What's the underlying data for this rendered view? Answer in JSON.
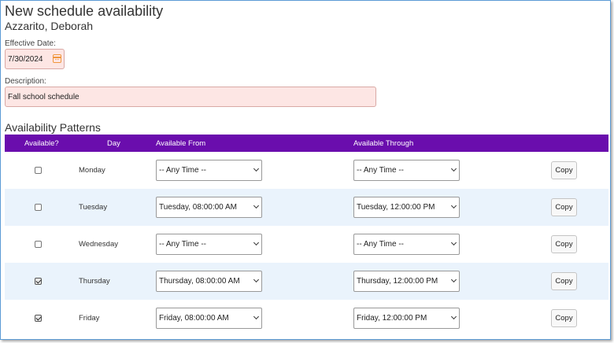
{
  "header": {
    "title": "New schedule availability",
    "employee": "Azzarito, Deborah"
  },
  "form": {
    "effective_date_label": "Effective Date:",
    "effective_date": "7/30/2024",
    "description_label": "Description:",
    "description": "Fall school schedule"
  },
  "patterns": {
    "title": "Availability Patterns",
    "columns": {
      "available": "Available?",
      "day": "Day",
      "from": "Available From",
      "through": "Available Through"
    },
    "copy_label": "Copy",
    "rows": [
      {
        "day": "Monday",
        "available": false,
        "from": "-- Any Time --",
        "through": "-- Any Time --"
      },
      {
        "day": "Tuesday",
        "available": false,
        "from": "Tuesday, 08:00:00 AM",
        "through": "Tuesday, 12:00:00 PM"
      },
      {
        "day": "Wednesday",
        "available": false,
        "from": "-- Any Time --",
        "through": "-- Any Time --"
      },
      {
        "day": "Thursday",
        "available": true,
        "from": "Thursday, 08:00:00 AM",
        "through": "Thursday, 12:00:00 PM"
      },
      {
        "day": "Friday",
        "available": true,
        "from": "Friday, 08:00:00 AM",
        "through": "Friday, 12:00:00 PM"
      }
    ]
  },
  "colors": {
    "header_bg": "#6a0dad",
    "alt_row_bg": "#eaf3fc",
    "input_bg": "#fde6e4",
    "calendar_icon": "#f0963c"
  }
}
